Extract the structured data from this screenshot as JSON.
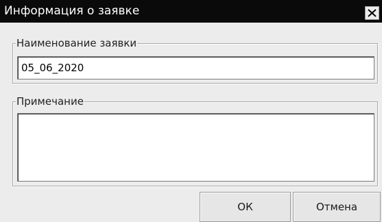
{
  "window": {
    "title": "Информация о заявке",
    "close_icon": "close-icon"
  },
  "name_group": {
    "label": "Наименование заявки",
    "value": "05_06_2020"
  },
  "note_group": {
    "label": "Примечание",
    "value": ""
  },
  "buttons": {
    "ok_label": "ОК",
    "cancel_label": "Отмена"
  },
  "colors": {
    "titlebar_bg": "#0a0a0a",
    "title_text": "#ffffff",
    "dialog_bg": "#ececec",
    "field_bg": "#ffffff"
  }
}
